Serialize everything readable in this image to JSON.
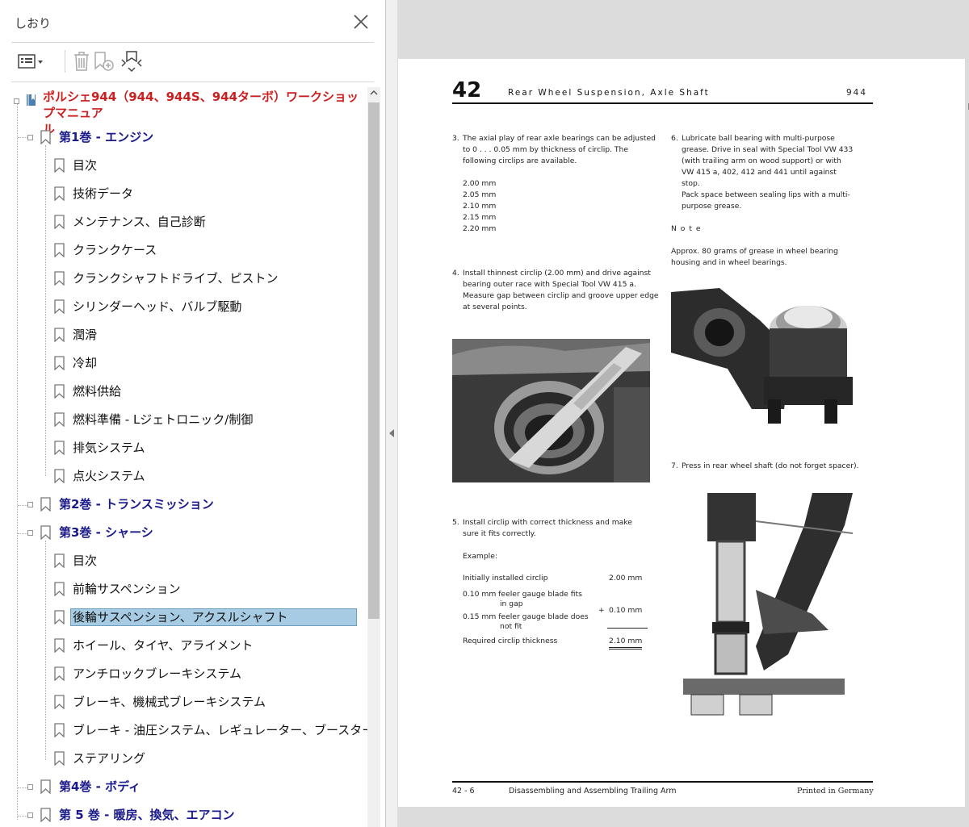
{
  "panel": {
    "title": "しおり",
    "tree": [
      {
        "type": "root",
        "label": "ポルシェ944（944、944S、944ターボ）ワークショップマニュアル",
        "label_line1": "ポルシェ944（944、944S、944ターボ）ワークショップマニュア",
        "label_line2": "ル"
      },
      {
        "type": "vol",
        "label": "第1巻 - エンジン"
      },
      {
        "type": "item",
        "label": "目次"
      },
      {
        "type": "item",
        "label": "技術データ"
      },
      {
        "type": "item",
        "label": "メンテナンス、自己診断"
      },
      {
        "type": "item",
        "label": "クランクケース"
      },
      {
        "type": "item",
        "label": "クランクシャフトドライブ、ピストン"
      },
      {
        "type": "item",
        "label": "シリンダーヘッド、バルブ駆動"
      },
      {
        "type": "item",
        "label": "潤滑"
      },
      {
        "type": "item",
        "label": "冷却"
      },
      {
        "type": "item",
        "label": "燃料供給"
      },
      {
        "type": "item",
        "label": "燃料準備 - Lジェトロニック/制御"
      },
      {
        "type": "item",
        "label": "排気システム"
      },
      {
        "type": "item",
        "label": "点火システム"
      },
      {
        "type": "vol",
        "label": "第2巻 - トランスミッション"
      },
      {
        "type": "vol",
        "label": "第3巻 - シャーシ"
      },
      {
        "type": "item",
        "label": "目次"
      },
      {
        "type": "item",
        "label": "前輪サスペンション"
      },
      {
        "type": "item",
        "label": "後輪サスペンション、アクスルシャフト",
        "selected": true
      },
      {
        "type": "item",
        "label": "ホイール、タイヤ、アライメント"
      },
      {
        "type": "item",
        "label": "アンチロックブレーキシステム"
      },
      {
        "type": "item",
        "label": "ブレーキ、機械式ブレーキシステム"
      },
      {
        "type": "item",
        "label": "ブレーキ - 油圧システム、レギュレーター、ブースター"
      },
      {
        "type": "item",
        "label": "ステアリング"
      },
      {
        "type": "vol",
        "label": "第4巻 - ボディ"
      },
      {
        "type": "vol",
        "label": "第 5 巻 - 暖房、換気、エアコン"
      }
    ]
  },
  "page": {
    "number": "42",
    "header": "Rear Wheel Suspension, Axle Shaft",
    "model": "944",
    "step3_num": "3.",
    "step3": [
      "The axial play of rear axle bearings can be adjusted",
      "to 0 . . . 0.05 mm by thickness of circlip. The",
      "following circlips are available."
    ],
    "circlips": [
      "2.00 mm",
      "2.05 mm",
      "2.10 mm",
      "2.15 mm",
      "2.20 mm"
    ],
    "step4_num": "4.",
    "step4": [
      "Install thinnest circlip (2.00 mm) and drive against",
      "bearing outer race with Special Tool VW 415 a.",
      "Measure gap between circlip and groove upper edge",
      "at several points."
    ],
    "step5_num": "5.",
    "step5": [
      "Install circlip with correct thickness and make",
      "sure it fits correctly."
    ],
    "example_label": "Example:",
    "example": {
      "r1_label": "Initially installed circlip",
      "r1_value": "2.00 mm",
      "r2_label": "0.10 mm feeler gauge blade fits",
      "r2_label2": "in gap",
      "r2_op": "+",
      "r2_value": "0.10 mm",
      "r3_label": "0.15 mm feeler gauge blade does",
      "r3_label2": "not fit",
      "r4_label": "Required circlip thickness",
      "r4_value": "2.10 mm"
    },
    "step6_num": "6.",
    "step6": [
      "Lubricate ball bearing with multi-purpose",
      "grease. Drive in seal with Special Tool VW 433",
      "(with trailing arm on wood support) or with",
      "VW 415 a, 402, 412 and 441 until against",
      "stop.",
      "Pack space between sealing lips with a multi-",
      "purpose grease."
    ],
    "note_label": "N o t e",
    "note": [
      "Approx. 80 grams of grease in wheel bearing",
      "housing and in wheel bearings."
    ],
    "step7_num": "7.",
    "step7": "Press in rear wheel shaft (do not forget spacer).",
    "footer_page": "42 - 6",
    "footer_title": "Disassembling and Assembling Trailing Arm",
    "footer_print": "Printed in Germany"
  }
}
